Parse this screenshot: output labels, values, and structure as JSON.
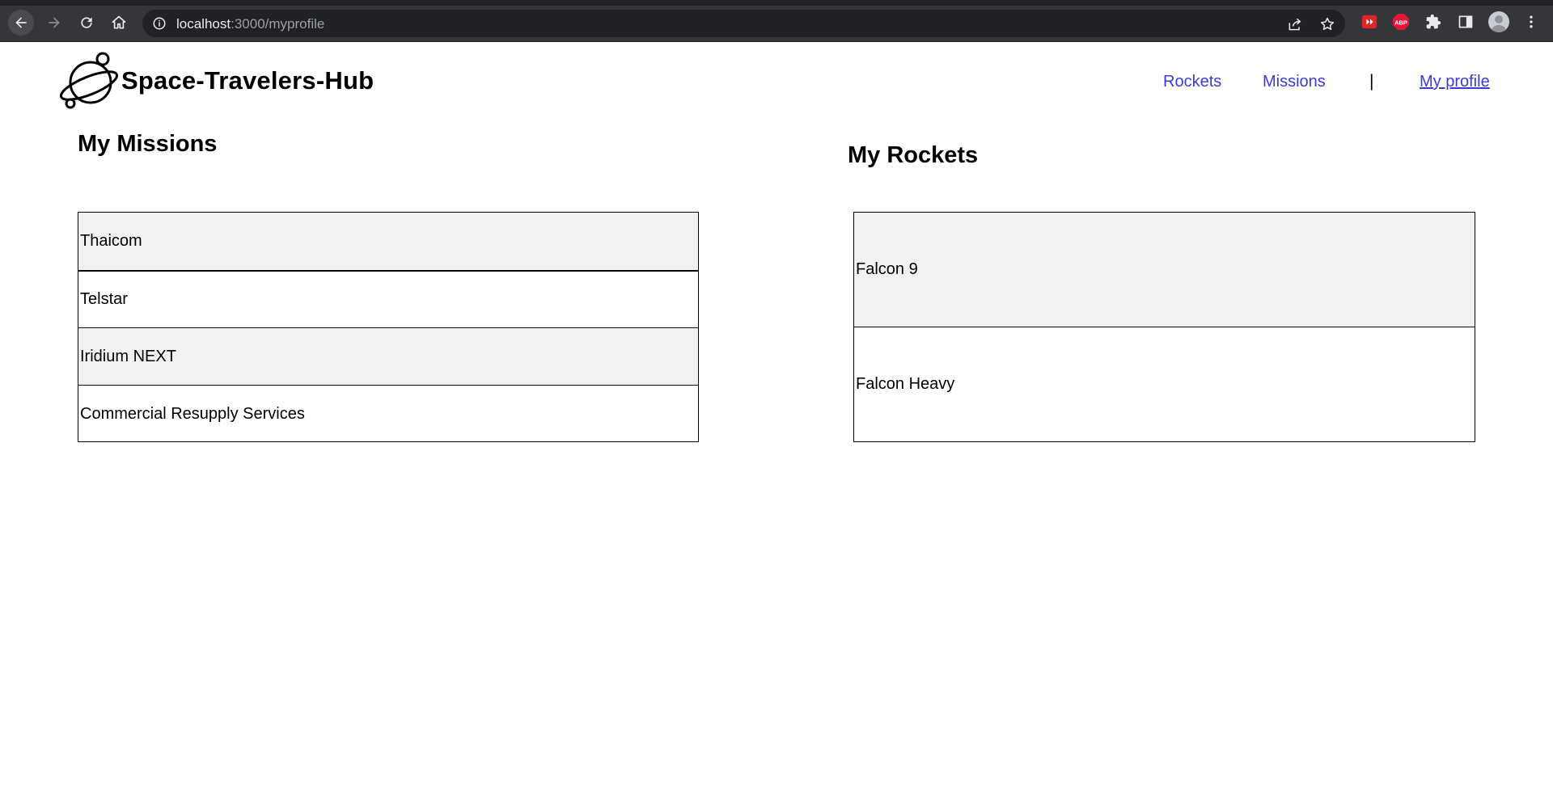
{
  "browser": {
    "url_host": "localhost",
    "url_path": ":3000/myprofile",
    "extensions": [
      "video-ext-icon",
      "abp-icon",
      "puzzle-icon"
    ],
    "abp_label": "ABP"
  },
  "header": {
    "brand": "Space-Travelers-Hub",
    "nav": {
      "rockets": "Rockets",
      "missions": "Missions",
      "separator": "|",
      "my_profile": "My profile"
    },
    "link_color": "#3b3bd6"
  },
  "missions": {
    "title": "My Missions",
    "items": [
      "Thaicom",
      "Telstar",
      "Iridium NEXT",
      "Commercial Resupply Services"
    ]
  },
  "rockets": {
    "title": "My Rockets",
    "items": [
      "Falcon 9",
      "Falcon Heavy"
    ]
  },
  "colors": {
    "row_alt": "#f2f0f0",
    "chrome_bg": "#35363a",
    "omnibox_bg": "#202124"
  }
}
